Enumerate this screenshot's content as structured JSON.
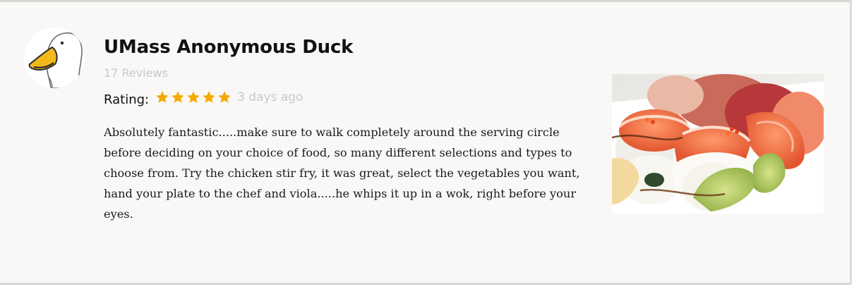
{
  "review": {
    "reviewer_name": "UMass Anonymous Duck",
    "review_count": "17 Reviews",
    "rating_label": "Rating:",
    "rating_value": 5,
    "rating_max": 5,
    "date": "3 days ago",
    "body": "Absolutely fantastic.....make sure to walk completely around the serving circle before deciding on your choice of food, so many different selections and types to choose from. Try the chicken stir fry, it was great, select the vegetables you want, hand your plate to the chef and viola.....he whips it up in a wok, right before your eyes."
  },
  "avatar": {
    "icon": "duck-avatar-icon"
  },
  "photo": {
    "subject": "sushi-roll-photo"
  },
  "colors": {
    "card_background": "#f9f8f6",
    "star": "#f5a900",
    "muted_text": "#c9c9c9",
    "border": "#d6d6d3"
  }
}
